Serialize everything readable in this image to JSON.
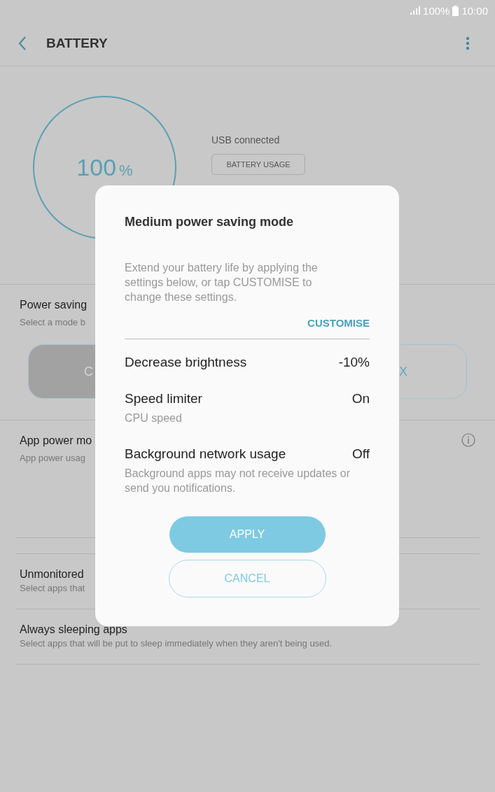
{
  "status_bar": {
    "battery": "100%",
    "time": "10:00"
  },
  "header": {
    "title": "BATTERY"
  },
  "battery": {
    "percent": "100",
    "unit": "%",
    "status": "USB connected",
    "usage_button": "BATTERY USAGE"
  },
  "power_saving": {
    "title": "Power saving",
    "subtitle": "Select a mode b",
    "modes": [
      {
        "label": "C",
        "selected": true
      },
      {
        "label": "X",
        "selected": false
      }
    ]
  },
  "app_power": {
    "title": "App power mo",
    "subtitle": "App power usag"
  },
  "list": [
    {
      "title": "Unmonitored",
      "subtitle": "Select apps that"
    },
    {
      "title": "Always sleeping apps",
      "subtitle": "Select apps that will be put to sleep immediately when they aren't being used."
    }
  ],
  "dialog": {
    "title": "Medium power saving mode",
    "description": "Extend your battery life by applying the settings below, or tap CUSTOMISE to change these settings.",
    "customise": "CUSTOMISE",
    "settings": [
      {
        "name": "Decrease brightness",
        "value": "-10%"
      },
      {
        "name": "Speed limiter",
        "value": "On",
        "note": "CPU speed"
      },
      {
        "name": "Background network usage",
        "value": "Off",
        "note": "Background apps may not receive updates or send you notifications."
      }
    ],
    "apply": "APPLY",
    "cancel": "CANCEL"
  }
}
